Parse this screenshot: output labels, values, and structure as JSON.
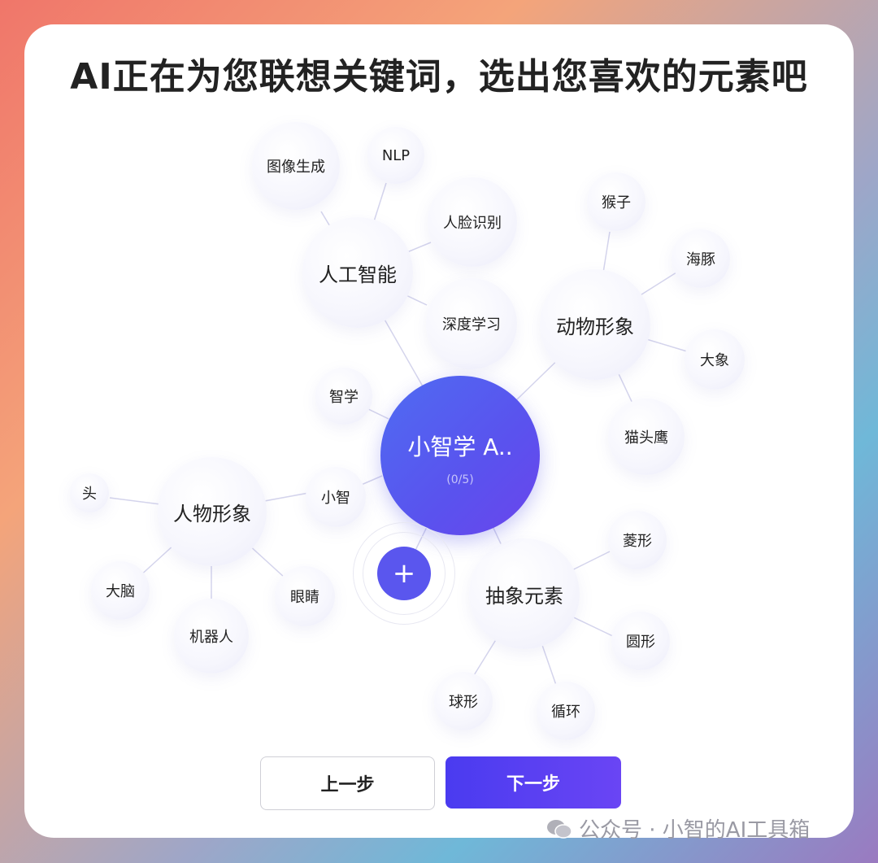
{
  "title": "AI正在为您联想关键词，选出您喜欢的元素吧",
  "center": {
    "label": "小智学 A..",
    "count": "(0/5)"
  },
  "groups": {
    "ai": {
      "label": "人工智能",
      "children": [
        "图像生成",
        "NLP",
        "人脸识别",
        "深度学习"
      ]
    },
    "animal": {
      "label": "动物形象",
      "children": [
        "猴子",
        "海豚",
        "大象",
        "猫头鹰"
      ]
    },
    "person": {
      "label": "人物形象",
      "children": [
        "头",
        "大脑",
        "机器人",
        "眼睛"
      ]
    },
    "abstract": {
      "label": "抽象元素",
      "children": [
        "菱形",
        "圆形",
        "循环",
        "球形"
      ]
    }
  },
  "direct": [
    "智学",
    "小智"
  ],
  "add_label": "+",
  "buttons": {
    "prev": "上一步",
    "next": "下一步"
  },
  "watermark": "公众号 · 小智的AI工具箱",
  "colors": {
    "primary": "#5a56ee",
    "line": "#d4d4ec"
  }
}
